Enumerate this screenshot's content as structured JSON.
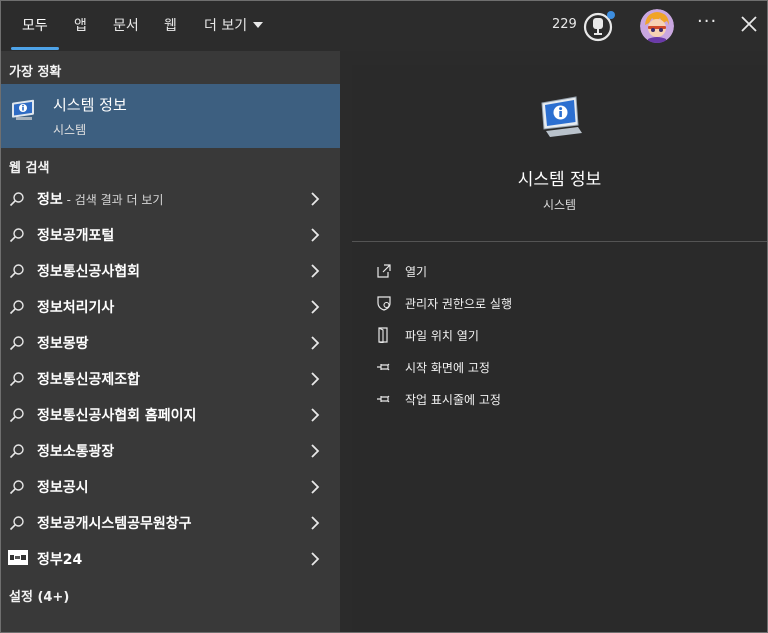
{
  "tabs": [
    {
      "label": "모두",
      "active": true
    },
    {
      "label": "앱"
    },
    {
      "label": "문서"
    },
    {
      "label": "웹"
    },
    {
      "label": "더 보기"
    }
  ],
  "header": {
    "points": "229",
    "reward_icon": "trophy-icon",
    "more_label": "···",
    "close_icon": "close-icon"
  },
  "left": {
    "best_match_label": "가장 정확",
    "best_match": {
      "title": "시스템 정보",
      "subtitle": "시스템",
      "icon": "system-info-icon"
    },
    "web_label": "웹 검색",
    "web_results": [
      {
        "text": "정보",
        "suffix": " - 검색 결과 더 보기"
      },
      {
        "text": "정보공개포털"
      },
      {
        "text": "정보통신공사협회"
      },
      {
        "text": "정보처리기사"
      },
      {
        "text": "정보몽땅"
      },
      {
        "text": "정보통신공제조합"
      },
      {
        "text": "정보통신공사협회 홈페이지"
      },
      {
        "text": "정보소통광장"
      },
      {
        "text": "정보공시"
      },
      {
        "text": "정보공개시스템공무원창구"
      },
      {
        "text": "정부24",
        "icon": "gov24-logo-icon"
      }
    ],
    "settings_label": "설정 (4+)"
  },
  "right": {
    "title": "시스템 정보",
    "subtitle": "시스템",
    "actions": [
      {
        "label": "열기",
        "icon": "open-icon"
      },
      {
        "label": "관리자 권한으로 실행",
        "icon": "shield-icon"
      },
      {
        "label": "파일 위치 열기",
        "icon": "file-location-icon"
      },
      {
        "label": "시작 화면에 고정",
        "icon": "pin-icon"
      },
      {
        "label": "작업 표시줄에 고정",
        "icon": "pin-icon"
      }
    ]
  },
  "colors": {
    "accent": "#4ea3e8",
    "selected_bg": "#3d5f80",
    "left_bg": "#393939",
    "right_bg": "#2a2a2a"
  }
}
